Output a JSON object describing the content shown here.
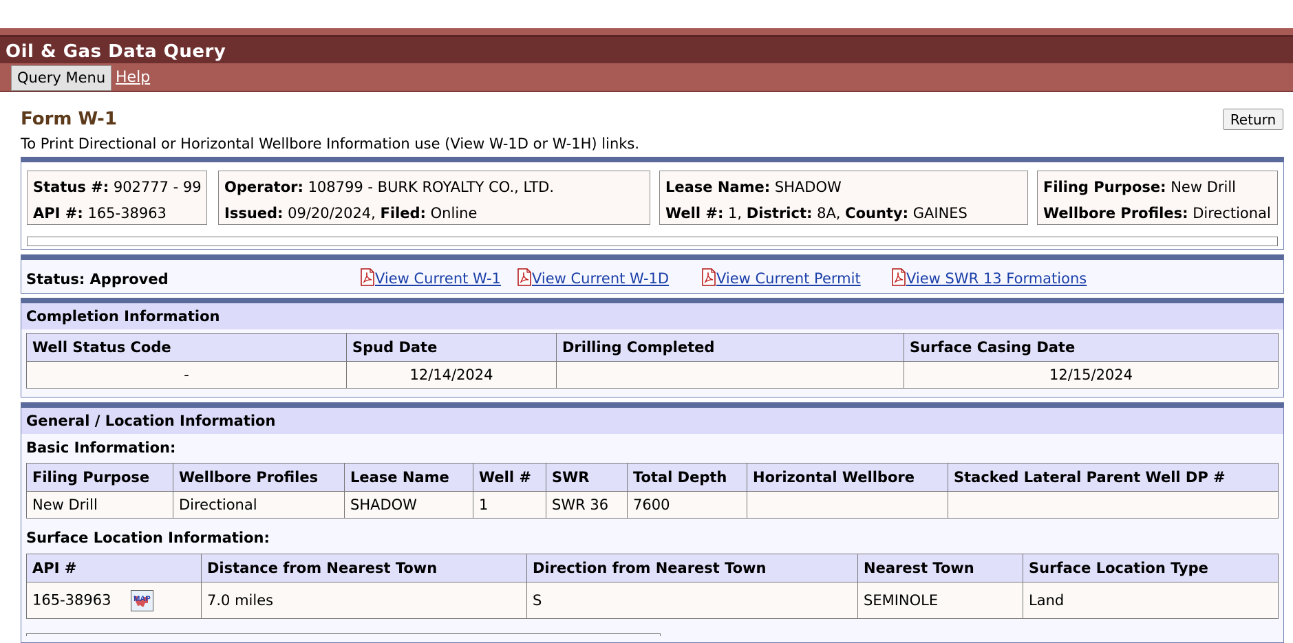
{
  "app": {
    "title": "Oil & Gas Data Query"
  },
  "menu": {
    "query_menu": "Query Menu",
    "help": "Help"
  },
  "form": {
    "title": "Form W-1",
    "return_label": "Return",
    "instruction": "To Print Directional or Horizontal Wellbore Information use (View W-1D or W-1H) links."
  },
  "header": {
    "status_no_label": "Status #:",
    "status_no": "902777 - 99",
    "api_label": "API #:",
    "api": "165-38963",
    "operator_label": "Operator:",
    "operator": "108799 - BURK ROYALTY CO., LTD.",
    "issued_label": "Issued:",
    "issued": "09/20/2024,",
    "filed_label": "Filed:",
    "filed": "Online",
    "lease_label": "Lease Name:",
    "lease": "SHADOW",
    "well_label": "Well #:",
    "well": "1,",
    "district_label": "District:",
    "district": "8A,",
    "county_label": "County:",
    "county": "GAINES",
    "filing_purpose_label": "Filing Purpose:",
    "filing_purpose": "New Drill",
    "wellbore_label": "Wellbore Profiles:",
    "wellbore": "Directional"
  },
  "status_bar": {
    "status": "Status: Approved",
    "links": [
      "View Current W-1",
      "View Current W-1D",
      "View Current Permit",
      "View SWR 13 Formations"
    ]
  },
  "completion": {
    "title": "Completion Information",
    "headers": [
      "Well Status Code",
      "Spud Date",
      "Drilling Completed",
      "Surface Casing Date"
    ],
    "row": [
      "-",
      "12/14/2024",
      "",
      "12/15/2024"
    ]
  },
  "general": {
    "title": "General / Location Information",
    "basic_title": "Basic Information:",
    "basic_headers": [
      "Filing Purpose",
      "Wellbore Profiles",
      "Lease Name",
      "Well #",
      "SWR",
      "Total Depth",
      "Horizontal Wellbore",
      "Stacked Lateral Parent Well DP #"
    ],
    "basic_row": [
      "New Drill",
      "Directional",
      "SHADOW",
      "1",
      "SWR 36",
      "7600",
      "",
      ""
    ],
    "surface_title": "Surface Location Information:",
    "surface_headers": [
      "API #",
      "Distance from Nearest Town",
      "Direction from Nearest Town",
      "Nearest Town",
      "Surface Location Type"
    ],
    "surface_row": [
      "165-38963",
      "7.0 miles",
      "S",
      "SEMINOLE",
      "Land"
    ],
    "map_icon_text": "MAP"
  },
  "colors": {
    "title_bar": "#6e2f2f",
    "menu_bar": "#a85a55",
    "panel_border": "#5a6a9a",
    "section_header": "#dcdcfa",
    "link": "#1a3fa8"
  },
  "icons": {
    "pdf": "pdf-icon",
    "map": "map-icon"
  }
}
